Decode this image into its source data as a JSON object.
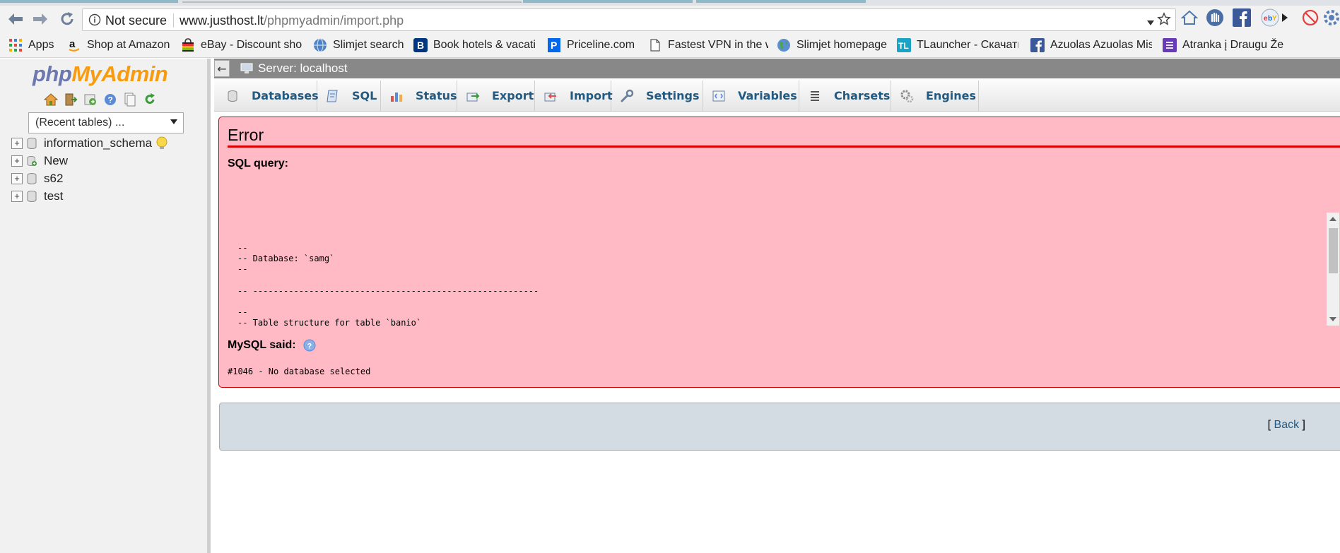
{
  "browser": {
    "security_label": "Not secure",
    "url_host": "www.justhost.lt",
    "url_path": "/phpmyadmin/import.php",
    "bookmarks": [
      {
        "label": "Apps",
        "icon": "apps-grid-icon"
      },
      {
        "label": "Shop at Amazon",
        "icon": "amazon-icon"
      },
      {
        "label": "eBay - Discount shop",
        "icon": "ebay-bag-icon"
      },
      {
        "label": "Slimjet search",
        "icon": "slimjet-globe-icon"
      },
      {
        "label": "Book hotels & vacati",
        "icon": "booking-icon"
      },
      {
        "label": "Priceline.com",
        "icon": "priceline-icon"
      },
      {
        "label": "Fastest VPN in the w",
        "icon": "page-icon"
      },
      {
        "label": "Slimjet homepage",
        "icon": "globe-icon"
      },
      {
        "label": "TLauncher - Скачать",
        "icon": "tlauncher-icon"
      },
      {
        "label": "Azuolas Azuolas Mis",
        "icon": "facebook-icon"
      },
      {
        "label": "Atranka į Draugu Že",
        "icon": "list-icon"
      }
    ]
  },
  "nav": {
    "logo_php": "php",
    "logo_myadmin": "MyAdmin",
    "recent_tables": "(Recent tables) ...",
    "databases": [
      {
        "name": "information_schema"
      },
      {
        "name": "New"
      },
      {
        "name": "s62"
      },
      {
        "name": "test"
      }
    ]
  },
  "main": {
    "server_label": "Server: localhost",
    "tabs": [
      {
        "label": "Databases",
        "icon": "database-icon"
      },
      {
        "label": "SQL",
        "icon": "sql-icon"
      },
      {
        "label": "Status",
        "icon": "status-icon"
      },
      {
        "label": "Export",
        "icon": "export-icon"
      },
      {
        "label": "Import",
        "icon": "import-icon"
      },
      {
        "label": "Settings",
        "icon": "wrench-icon"
      },
      {
        "label": "Variables",
        "icon": "variables-icon"
      },
      {
        "label": "Charsets",
        "icon": "charsets-icon"
      },
      {
        "label": "Engines",
        "icon": "engines-icon"
      }
    ],
    "error": {
      "title": "Error",
      "sql_query_label": "SQL query:",
      "sql_code": "--\n-- Database: `samg`\n--\n\n-- --------------------------------------------------------\n\n--\n-- Table structure for table `banio`",
      "mysql_said_label": "MySQL said:",
      "message": "#1046 - No database selected"
    },
    "back_open": "[ ",
    "back_link": "Back",
    "back_close": " ]"
  },
  "colors": {
    "error_bg": "#ffbac5",
    "error_rule": "#dd0000",
    "link": "#235a81",
    "server_bar": "#888888"
  }
}
